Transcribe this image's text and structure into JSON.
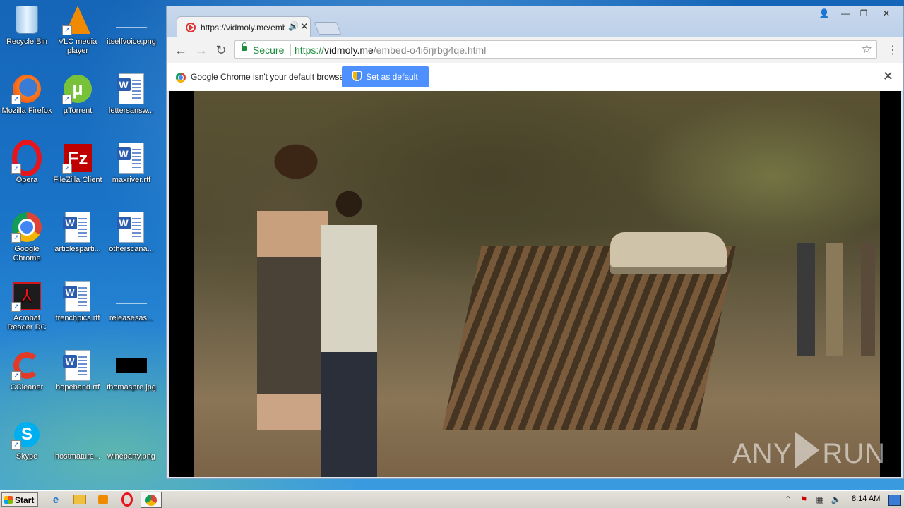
{
  "desktop": {
    "icons": [
      {
        "label": "Recycle Bin"
      },
      {
        "label": "VLC media player"
      },
      {
        "label": "itselfvoice.png"
      },
      {
        "label": "Mozilla Firefox"
      },
      {
        "label": "µTorrent"
      },
      {
        "label": "lettersansw..."
      },
      {
        "label": "Opera"
      },
      {
        "label": "FileZilla Client"
      },
      {
        "label": "maxriver.rtf"
      },
      {
        "label": "Google Chrome"
      },
      {
        "label": "articlesparti..."
      },
      {
        "label": "otherscana..."
      },
      {
        "label": "Acrobat Reader DC"
      },
      {
        "label": "frenchpics.rtf"
      },
      {
        "label": "releasesas..."
      },
      {
        "label": "CCleaner"
      },
      {
        "label": "hopeband.rtf"
      },
      {
        "label": "thomaspre.jpg"
      },
      {
        "label": "Skype"
      },
      {
        "label": "hostmature..."
      },
      {
        "label": "wineparty.png"
      }
    ]
  },
  "browser": {
    "tab": {
      "title": "https://vidmoly.me/emb"
    },
    "omnibox": {
      "secure_label": "Secure",
      "url_scheme": "https://",
      "url_domain": "vidmoly.me",
      "url_path": "/embed-o4i6rjrbg4qe.html"
    },
    "infobar": {
      "message": "Google Chrome isn't your default browser.",
      "button_label": "Set as default"
    },
    "watermark": {
      "left": "ANY",
      "right": "RUN"
    }
  },
  "taskbar": {
    "start_label": "Start",
    "clock": "8:14 AM"
  },
  "colors": {
    "secure_green": "#1e8e3e",
    "infobar_button": "#4d90fe"
  }
}
